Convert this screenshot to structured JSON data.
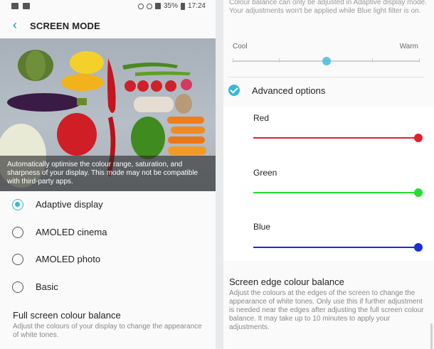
{
  "left_panel": {
    "status": {
      "battery": "35%",
      "time": "17:24"
    },
    "header": {
      "back_icon": "arrow-left-icon",
      "title": "SCREEN MODE"
    },
    "hero": {
      "caption": "Automatically optimise the colour range, saturation, and sharpness of your display. This mode may not be compatible with third-party apps."
    },
    "modes": [
      {
        "label": "Adaptive display",
        "selected": true
      },
      {
        "label": "AMOLED cinema",
        "selected": false
      },
      {
        "label": "AMOLED photo",
        "selected": false
      },
      {
        "label": "Basic",
        "selected": false
      }
    ],
    "full_screen": {
      "title": "Full screen colour balance",
      "desc": "Adjust the colours of your display to change the appearance of white tones."
    }
  },
  "right_panel": {
    "top_desc": "Colour balance can only be adjusted in Adaptive display mode. Your adjustments won't be applied while Blue light filter is on.",
    "temperature": {
      "cool_label": "Cool",
      "warm_label": "Warm",
      "value": 0.5
    },
    "advanced": {
      "label": "Advanced options",
      "checked": true
    },
    "channels": [
      {
        "label": "Red",
        "color": "#e0202a",
        "value": 1.0
      },
      {
        "label": "Green",
        "color": "#22e02a",
        "value": 1.0
      },
      {
        "label": "Blue",
        "color": "#1a2fd8",
        "value": 1.0
      }
    ],
    "edge": {
      "title": "Screen edge colour balance",
      "desc": "Adjust the colours at the edges of the screen to change the appearance of white tones. Only use this if further adjustment is needed near the edges after adjusting the full screen colour balance. It may take up to 10 minutes to apply your adjustments."
    }
  },
  "colors": {
    "accent": "#3ab7d6"
  }
}
